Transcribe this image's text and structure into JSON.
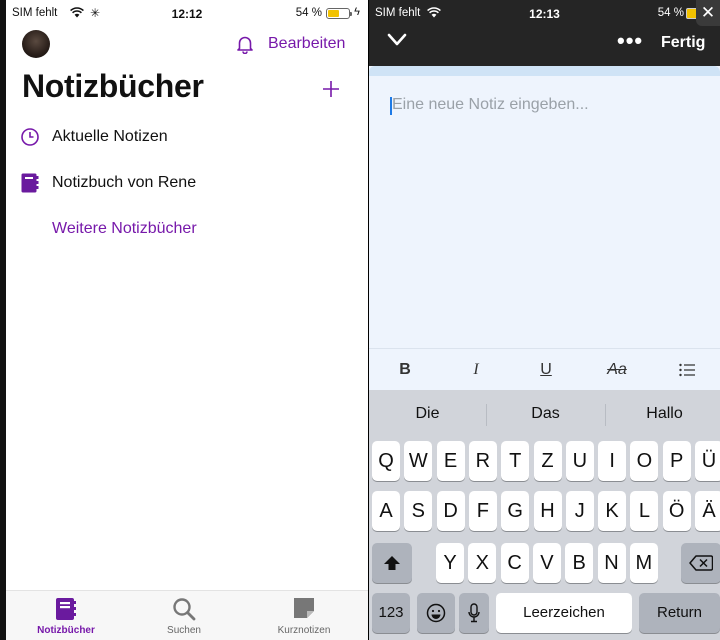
{
  "left": {
    "status": {
      "carrier": "SIM fehlt",
      "time": "12:12",
      "battery": "54 %"
    },
    "header": {
      "edit": "Bearbeiten",
      "title": "Notizbücher"
    },
    "nav": [
      {
        "label": "Aktuelle Notizen",
        "icon": "clock-icon"
      },
      {
        "label": "Notizbuch von Rene",
        "icon": "notebook-icon"
      }
    ],
    "more_notebooks": "Weitere Notizbücher",
    "tabs": [
      {
        "label": "Notizbücher",
        "icon": "notebook-icon",
        "active": true
      },
      {
        "label": "Suchen",
        "icon": "search-icon",
        "active": false
      },
      {
        "label": "Kurznotizen",
        "icon": "sticky-note-icon",
        "active": false
      }
    ],
    "accent": "#7719aa",
    "battery_level": 0.54
  },
  "right": {
    "status": {
      "carrier": "SIM fehlt",
      "time": "12:13",
      "battery": "54 %"
    },
    "header": {
      "done": "Fertig"
    },
    "editor": {
      "placeholder": "Eine neue Notiz eingeben..."
    },
    "format": {
      "bold": "B",
      "italic": "I",
      "underline": "U",
      "strike": "Aa"
    },
    "suggestions": [
      "Die",
      "Das",
      "Hallo"
    ],
    "keys": {
      "row1": [
        "Q",
        "W",
        "E",
        "R",
        "T",
        "Z",
        "U",
        "I",
        "O",
        "P",
        "Ü"
      ],
      "row2": [
        "A",
        "S",
        "D",
        "F",
        "G",
        "H",
        "J",
        "K",
        "L",
        "Ö",
        "Ä"
      ],
      "row3": [
        "Y",
        "X",
        "C",
        "V",
        "B",
        "N",
        "M"
      ],
      "numbers": "123",
      "space": "Leerzeichen",
      "return": "Return"
    }
  }
}
